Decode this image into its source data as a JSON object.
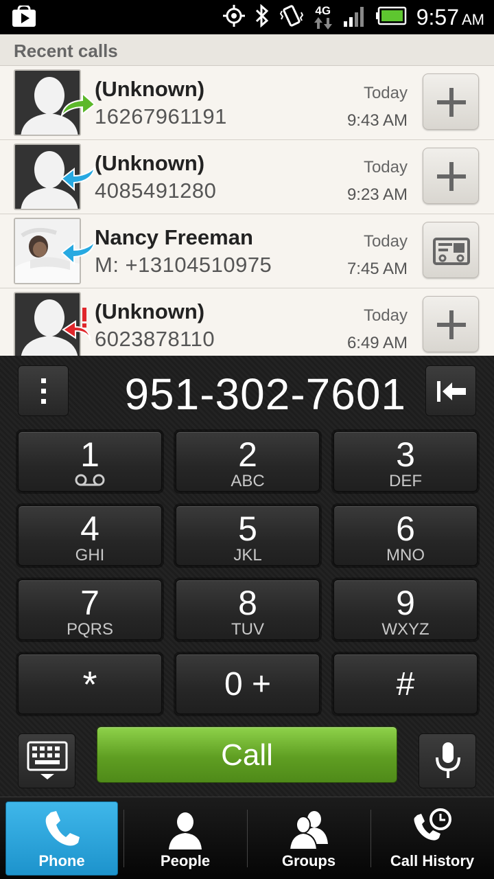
{
  "status_bar": {
    "network": "4G",
    "time": "9:57",
    "ampm": "AM"
  },
  "recent_calls": {
    "title": "Recent calls",
    "items": [
      {
        "name": "(Unknown)",
        "number": "16267961191",
        "date": "Today",
        "time": "9:43 AM",
        "direction": "outgoing",
        "direction_color": "#5cb82a",
        "action": "add-contact"
      },
      {
        "name": "(Unknown)",
        "number": "4085491280",
        "date": "Today",
        "time": "9:23 AM",
        "direction": "incoming",
        "direction_color": "#27a9e1",
        "action": "add-contact"
      },
      {
        "name": "Nancy Freeman",
        "number": "M: +13104510975",
        "date": "Today",
        "time": "7:45 AM",
        "direction": "incoming",
        "direction_color": "#27a9e1",
        "action": "contact-card"
      },
      {
        "name": "(Unknown)",
        "number": "6023878110",
        "date": "Today",
        "time": "6:49 AM",
        "direction": "missed",
        "direction_color": "#e0262b",
        "action": "add-contact"
      }
    ]
  },
  "dialer": {
    "entered_number": "951-302-7601",
    "keys": [
      {
        "digit": "1",
        "letters": ""
      },
      {
        "digit": "2",
        "letters": "ABC"
      },
      {
        "digit": "3",
        "letters": "DEF"
      },
      {
        "digit": "4",
        "letters": "GHI"
      },
      {
        "digit": "5",
        "letters": "JKL"
      },
      {
        "digit": "6",
        "letters": "MNO"
      },
      {
        "digit": "7",
        "letters": "PQRS"
      },
      {
        "digit": "8",
        "letters": "TUV"
      },
      {
        "digit": "9",
        "letters": "WXYZ"
      },
      {
        "digit": "*",
        "letters": ""
      },
      {
        "digit": "0 +",
        "letters": ""
      },
      {
        "digit": "#",
        "letters": ""
      }
    ],
    "call_label": "Call",
    "call_color": "#66a824"
  },
  "tabs": [
    {
      "label": "Phone",
      "icon": "phone-icon",
      "active": true
    },
    {
      "label": "People",
      "icon": "person-icon",
      "active": false
    },
    {
      "label": "Groups",
      "icon": "group-icon",
      "active": false
    },
    {
      "label": "Call History",
      "icon": "call-history-icon",
      "active": false
    }
  ],
  "colors": {
    "active_tab": "#2aa6dd",
    "list_background": "#f7f4ef"
  }
}
